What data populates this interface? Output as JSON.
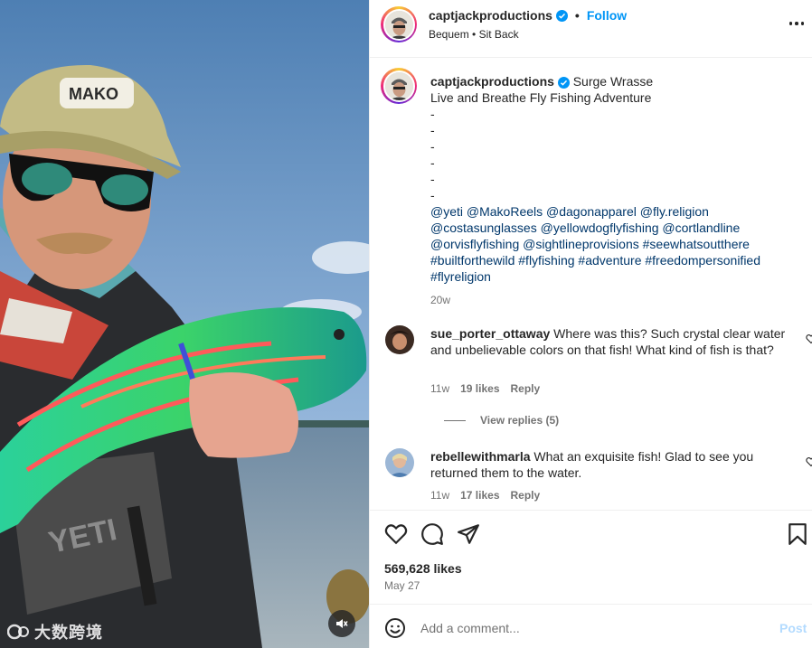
{
  "post": {
    "author": "captjackproductions",
    "follow_label": "Follow",
    "audio": "Bequem • Sit Back",
    "more_icon": "more-horizontal-icon"
  },
  "caption": {
    "author": "captjackproductions",
    "lines": [
      "Surge Wrasse",
      "Live and Breathe Fly Fishing Adventure",
      "-",
      "-",
      "-",
      "-",
      "-",
      "-",
      "@yeti @MakoReels @dagonapparel @fly.religion",
      "@costasunglasses @yellowdogflyfishing @cortlandline",
      "@orvisflyfishing @sightlineprovisions #seewhatsoutthere",
      "#builtforthewild #flyfishing #adventure #freedompersonified",
      "#flyreligion"
    ],
    "time": "20w"
  },
  "comments": [
    {
      "user": "sue_porter_ottaway",
      "text": "Where was this? Such crystal clear water and unbelievable colors on that fish! What kind of fish is that?",
      "time": "11w",
      "likes": "19 likes",
      "reply_label": "Reply",
      "view_replies": "View replies (5)"
    },
    {
      "user": "rebellewithmarla",
      "text": "What an exquisite fish! Glad to see you returned them to the water.",
      "time": "11w",
      "likes": "17 likes",
      "reply_label": "Reply"
    }
  ],
  "actions": {
    "likes": "569,628 likes",
    "date": "May 27",
    "icons": [
      "heart-icon",
      "comment-icon",
      "share-icon",
      "bookmark-icon"
    ]
  },
  "composer": {
    "placeholder": "Add a comment...",
    "post_label": "Post"
  },
  "media": {
    "watermark": "大数跨境",
    "hat_text": "MAKO",
    "pack_text": "YETI"
  },
  "colors": {
    "accent": "#0095f6",
    "link": "#00376b",
    "muted": "#737373",
    "post_disabled": "#b3dbff"
  }
}
